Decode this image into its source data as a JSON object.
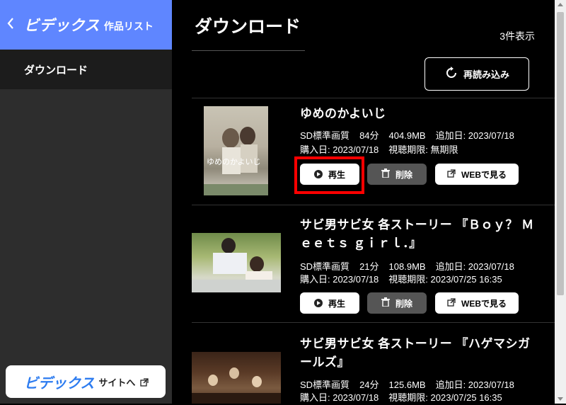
{
  "sidebar": {
    "back_icon": "chevron-left-icon",
    "brand": "ビデックス",
    "subtitle": "作品リスト",
    "items": [
      {
        "label": "ダウンロード"
      }
    ],
    "site_button": {
      "brand": "ビデックス",
      "label": "サイトへ",
      "icon": "external-link-icon"
    },
    "colors": {
      "header": "#5f86ff",
      "bg": "#2d2d2d",
      "brand_blue": "#2d7cf0"
    }
  },
  "main": {
    "title": "ダウンロード",
    "count_label": "3件表示",
    "reload_label": "再読み込み",
    "reload_icon": "reload-icon"
  },
  "items": [
    {
      "title": "ゆめのかよいじ",
      "quality": "SD標準画質",
      "duration": "84分",
      "size": "404.9MB",
      "added": "追加日: 2023/07/18",
      "purchased": "購入日: 2023/07/18",
      "expiry": "視聴期限: 無期限",
      "play_label": "再生",
      "delete_label": "削除",
      "web_label": "WEBで見る",
      "poster_text": "ゆめのかよいじ"
    },
    {
      "title": "サビ男サビ女 各ストーリー 『Ｂｏｙ？ Ｍｅｅｔｓ ｇｉｒｌ．』",
      "quality": "SD標準画質",
      "duration": "21分",
      "size": "108.9MB",
      "added": "追加日: 2023/07/18",
      "purchased": "購入日: 2023/07/18",
      "expiry": "視聴期限: 2023/07/25 16:35",
      "play_label": "再生",
      "delete_label": "削除",
      "web_label": "WEBで見る"
    },
    {
      "title": "サビ男サビ女 各ストーリー 『ハゲマシガールズ』",
      "quality": "SD標準画質",
      "duration": "24分",
      "size": "125.6MB",
      "added": "追加日: 2023/07/18",
      "purchased": "購入日: 2023/07/18",
      "expiry": "視聴期限: 2023/07/25 16:35"
    }
  ]
}
